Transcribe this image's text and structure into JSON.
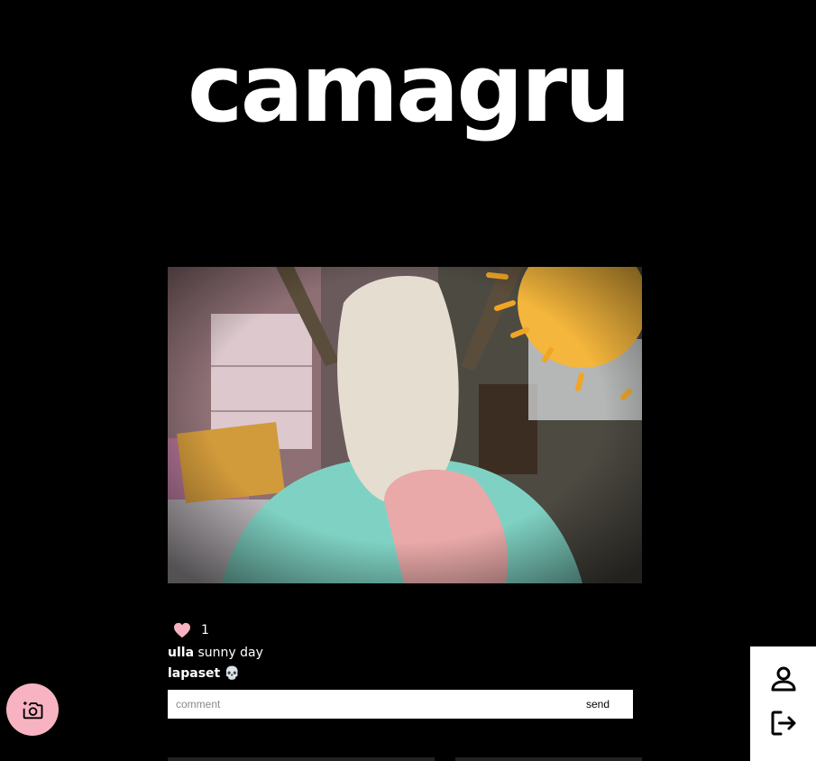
{
  "app": {
    "logo": "camagru"
  },
  "post": {
    "likes": "1",
    "caption_user": "ulla",
    "caption_text": "sunny day",
    "comments": [
      {
        "user": "lapaset",
        "text": "💀"
      }
    ]
  },
  "comment_form": {
    "placeholder": "comment",
    "send_label": "send"
  },
  "icons": {
    "like": "heart-icon",
    "camera": "add-photo-camera-icon",
    "profile": "user-profile-icon",
    "logout": "logout-icon"
  },
  "colors": {
    "background": "#000000",
    "heart": "#f7b3c1",
    "camera_button": "#f7b3c1",
    "sticker_sun": "#f4b63c"
  }
}
